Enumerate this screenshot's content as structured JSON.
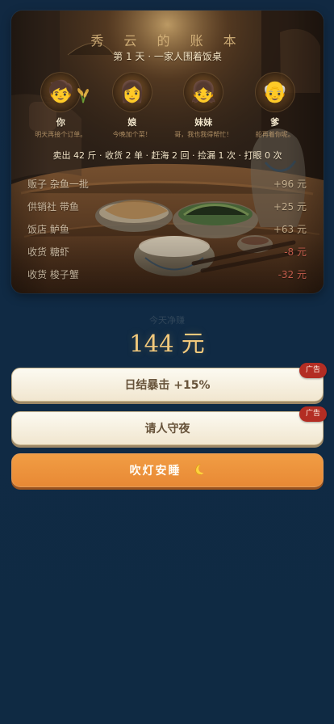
{
  "ledger": {
    "title": "秀 云 的 账 本",
    "day_title": "第 1 天 · 一家人围着饭桌",
    "family": [
      {
        "name": "你",
        "line": "明天再接个订单。",
        "icon": "child-face-icon"
      },
      {
        "name": "娘",
        "line": "今晚加个菜！",
        "icon": "mother-face-icon"
      },
      {
        "name": "妹妹",
        "line": "哥，我也我得帮忙！",
        "icon": "sister-face-icon"
      },
      {
        "name": "爹",
        "line": "船再着你呢。",
        "icon": "grandfather-face-icon"
      }
    ],
    "summary": "卖出 42 斤 · 收货 2 单 · 赶海 2 回 · 捡漏 1 次 · 打眼 0 次",
    "rows": [
      {
        "label": "贩子 杂鱼一批",
        "amount": "+96 元",
        "tone": "positive"
      },
      {
        "label": "供销社 带鱼",
        "amount": "+25 元",
        "tone": "positive"
      },
      {
        "label": "饭店 鲈鱼",
        "amount": "+63 元",
        "tone": "positive"
      },
      {
        "label": "收货 糖虾",
        "amount": "-8 元",
        "tone": "negative"
      },
      {
        "label": "收货 梭子蟹",
        "amount": "-32 元",
        "tone": "negative"
      }
    ]
  },
  "today": {
    "label": "今天净赚",
    "total": "144 元"
  },
  "actions": {
    "daily_boost": "日结暴击 +15%",
    "night_guard": "请人守夜",
    "ad_badge": "广告",
    "sleep": "吹灯安睡"
  },
  "colors": {
    "background": "#102a44",
    "accent": "#f2c97c",
    "sleep_button": "#f0963f",
    "ad_badge": "#b32d23",
    "negative": "#da6656"
  }
}
